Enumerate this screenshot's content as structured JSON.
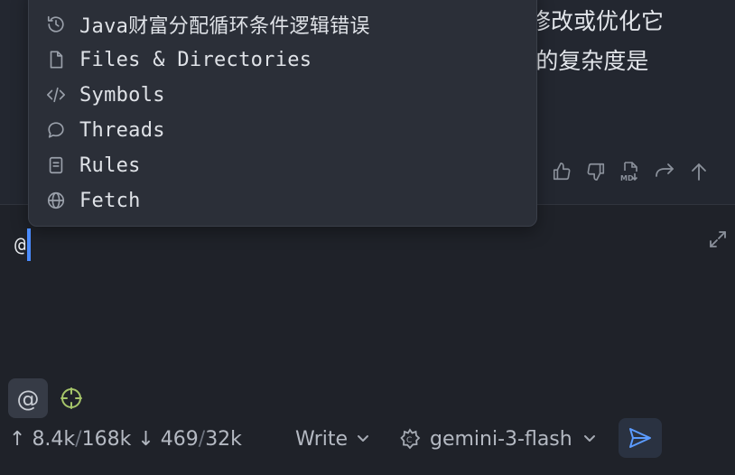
{
  "conversation": {
    "message_line_1": "你修改或优化它",
    "message_line_2": "|前的复杂度是"
  },
  "mention_menu": {
    "items": [
      {
        "label": "Java财富分配循环条件逻辑错误",
        "icon": "history-icon"
      },
      {
        "label": "Files & Directories",
        "icon": "file-icon"
      },
      {
        "label": "Symbols",
        "icon": "code-icon"
      },
      {
        "label": "Threads",
        "icon": "chat-bubble-icon"
      },
      {
        "label": "Rules",
        "icon": "rules-doc-icon"
      },
      {
        "label": "Fetch",
        "icon": "globe-icon"
      }
    ]
  },
  "editor": {
    "text": "@"
  },
  "status": {
    "up_arrow": "↑",
    "input_tokens": "8.4k",
    "sep": "/",
    "input_limit": "168k",
    "down_arrow": "↓",
    "output_tokens": "469",
    "output_limit": "32k"
  },
  "mode": {
    "label": "Write"
  },
  "model": {
    "label": "gemini-3-flash"
  },
  "colors": {
    "background": "#1f2229",
    "popup": "#2b2f38",
    "accent": "#4a8bff"
  }
}
